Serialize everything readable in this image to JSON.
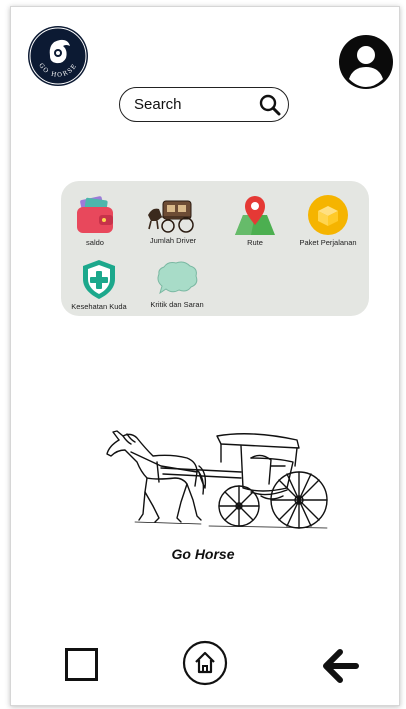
{
  "header": {
    "logo_text": "GO HORSE",
    "search": {
      "label": "Search"
    }
  },
  "menu": {
    "items": [
      {
        "label": "saldo",
        "icon": "wallet-icon"
      },
      {
        "label": "Jumlah Driver",
        "icon": "carriage-icon"
      },
      {
        "label": "Rute",
        "icon": "map-pin-icon"
      },
      {
        "label": "Paket Perjalanan",
        "icon": "package-icon"
      },
      {
        "label": "Kesehatan Kuda",
        "icon": "health-shield-icon"
      },
      {
        "label": "Kritik dan Saran",
        "icon": "chat-bubble-icon"
      }
    ]
  },
  "hero": {
    "caption": "Go Horse"
  },
  "navbar": {
    "items": [
      {
        "icon": "square-icon"
      },
      {
        "icon": "home-icon"
      },
      {
        "icon": "back-arrow-icon"
      }
    ]
  },
  "colors": {
    "logo_bg": "#0c1a33",
    "menu_panel_bg": "#e4e6e2",
    "wallet": "#e8485c",
    "map_pin": "#e53935",
    "map_land": "#4caf50",
    "package_bg": "#f5b400",
    "shield": "#1ca88c",
    "chat_bubble": "#a8dcc8"
  }
}
